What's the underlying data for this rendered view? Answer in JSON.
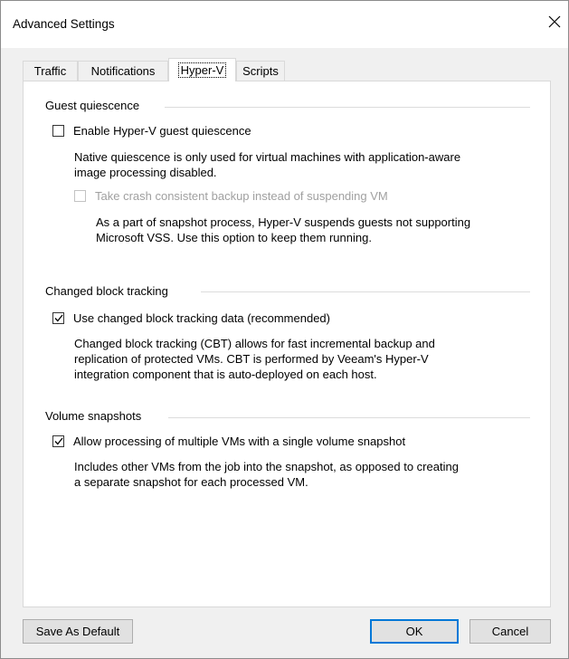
{
  "window": {
    "title": "Advanced Settings",
    "close_icon": "close-icon"
  },
  "tabs": [
    {
      "label": "Traffic",
      "active": false
    },
    {
      "label": "Notifications",
      "active": false
    },
    {
      "label": "Hyper-V",
      "active": true
    },
    {
      "label": "Scripts",
      "active": false
    }
  ],
  "guest_quiescence": {
    "title": "Guest quiescence",
    "enable": {
      "label": "Enable Hyper-V guest quiescence",
      "checked": false
    },
    "enable_desc_1": "Native quiescence is only used for virtual machines with application-aware",
    "enable_desc_2": "image processing disabled.",
    "crash": {
      "label": "Take crash consistent backup instead of suspending VM",
      "checked": false,
      "disabled": true
    },
    "crash_desc_1": "As a part of snapshot process, Hyper-V suspends guests not supporting",
    "crash_desc_2": "Microsoft VSS. Use this option to keep them running."
  },
  "cbt": {
    "title": "Changed block tracking",
    "use": {
      "label": "Use changed block tracking data (recommended)",
      "checked": true
    },
    "desc_1": "Changed block tracking (CBT) allows for fast incremental backup and",
    "desc_2": "replication of protected VMs. CBT is performed by Veeam's Hyper-V",
    "desc_3": "integration component that is auto-deployed on each host."
  },
  "volume": {
    "title": "Volume snapshots",
    "allow": {
      "label": "Allow processing of multiple VMs with a single volume snapshot",
      "checked": true
    },
    "desc_1": "Includes other VMs from the job into the snapshot, as opposed to creating",
    "desc_2": "a separate snapshot for each processed VM."
  },
  "buttons": {
    "save_default": "Save As Default",
    "ok": "OK",
    "cancel": "Cancel"
  },
  "colors": {
    "accent": "#0078d7",
    "window_bg": "#f0f0f0",
    "panel_bg": "#ffffff"
  }
}
